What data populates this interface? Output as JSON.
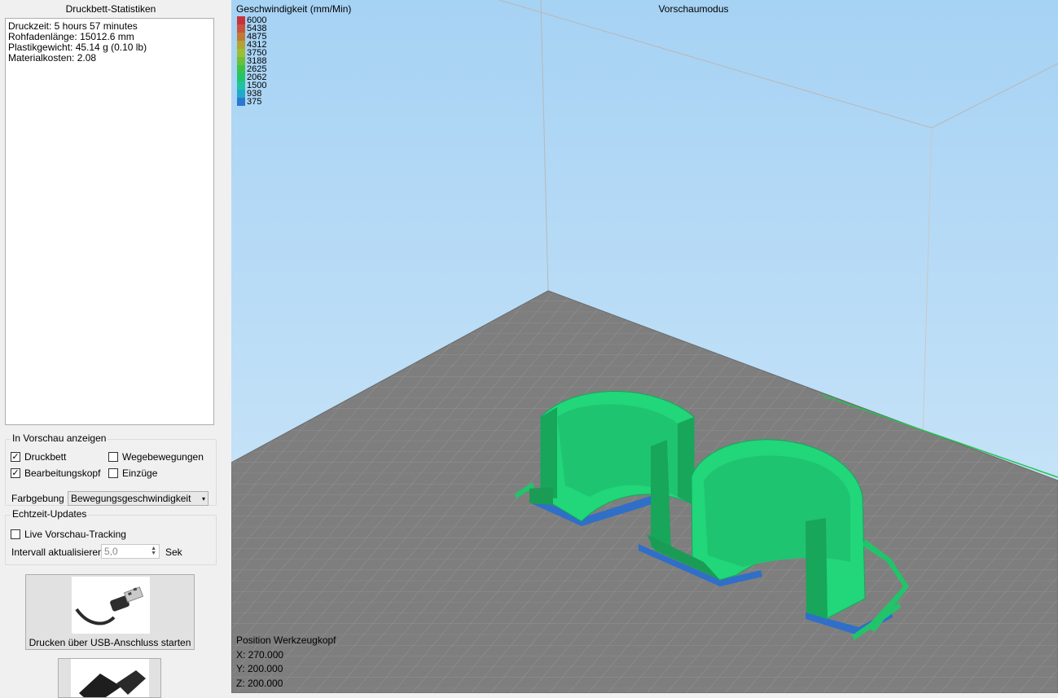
{
  "stats": {
    "title": "Druckbett-Statistiken",
    "lines": [
      "Druckzeit: 5 hours 57 minutes",
      "Rohfadenlänge: 15012.6 mm",
      "Plastikgewicht: 45.14 g (0.10 lb)",
      "Materialkosten: 2.08"
    ]
  },
  "preview_group": {
    "title": "In Vorschau anzeigen",
    "druckbett": {
      "label": "Druckbett",
      "checked": true
    },
    "wegebewegungen": {
      "label": "Wegebewegungen",
      "checked": false
    },
    "bearbeitungskopf": {
      "label": "Bearbeitungskopf",
      "checked": true
    },
    "einzuege": {
      "label": "Einzüge",
      "checked": false
    },
    "farbgebung_label": "Farbgebung",
    "farbgebung_value": "Bewegungsgeschwindigkeit"
  },
  "realtime_group": {
    "title": "Echtzeit-Updates",
    "live_tracking": {
      "label": "Live Vorschau-Tracking",
      "checked": false
    },
    "interval_label": "Intervall aktualisieren",
    "interval_value": "5,0",
    "interval_unit": "Sek"
  },
  "buttons": {
    "usb_print": "Drucken über USB-Anschluss starten"
  },
  "viewport": {
    "speed_title": "Geschwindigkeit (mm/Min)",
    "mode_title": "Vorschaumodus",
    "legend": [
      {
        "value": "6000",
        "color": "#c8323a"
      },
      {
        "value": "5438",
        "color": "#c8553a"
      },
      {
        "value": "4875",
        "color": "#c07a35"
      },
      {
        "value": "4312",
        "color": "#b2a335"
      },
      {
        "value": "3750",
        "color": "#9ebd35"
      },
      {
        "value": "3188",
        "color": "#6cc03a"
      },
      {
        "value": "2625",
        "color": "#3cc24a"
      },
      {
        "value": "2062",
        "color": "#22c46a"
      },
      {
        "value": "1500",
        "color": "#1ec4a0"
      },
      {
        "value": "938",
        "color": "#1eaac8"
      },
      {
        "value": "375",
        "color": "#2a78d0"
      }
    ],
    "position_title": "Position Werkzeugkopf",
    "position_x": "X: 270.000",
    "position_y": "Y: 200.000",
    "position_z": "Z: 200.000"
  },
  "colors": {
    "sky_top": "#a9d4f5",
    "sky_bottom": "#cfe7f8",
    "bed": "#7c7c7c",
    "model": "#22d67a",
    "model_base": "#2f6fc8"
  }
}
